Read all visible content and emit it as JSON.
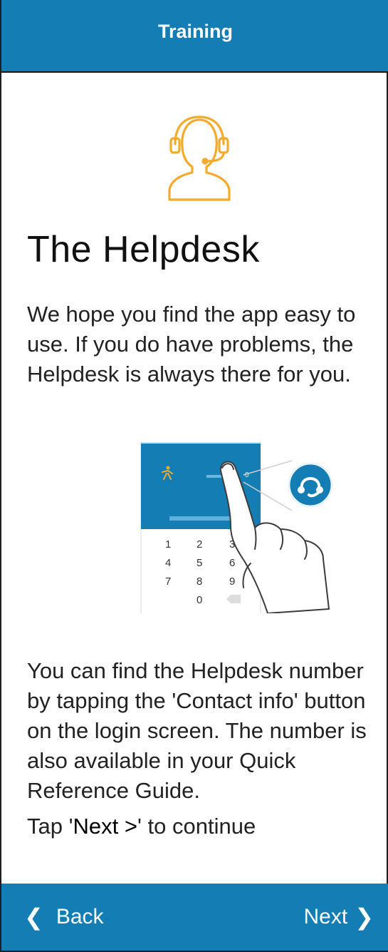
{
  "header": {
    "title": "Training"
  },
  "content": {
    "title": "The Helpdesk",
    "intro": "We hope you find the app easy to use. If you do have problems, the Helpdesk is always there for you.",
    "illustration": {
      "keypad": [
        "1",
        "2",
        "3",
        "4",
        "5",
        "6",
        "7",
        "8",
        "9",
        "0"
      ]
    },
    "details": "You can find the Helpdesk number by tapping the 'Contact info' button on the login screen. The number is also available in your Quick Reference Guide.",
    "tap_prefix": "Tap '",
    "tap_bold": "Next >",
    "tap_suffix": "' to continue"
  },
  "footer": {
    "back_label": "Back",
    "next_label": "Next"
  },
  "colors": {
    "brand_blue": "#137db4",
    "accent_orange": "#f4aa2a"
  }
}
